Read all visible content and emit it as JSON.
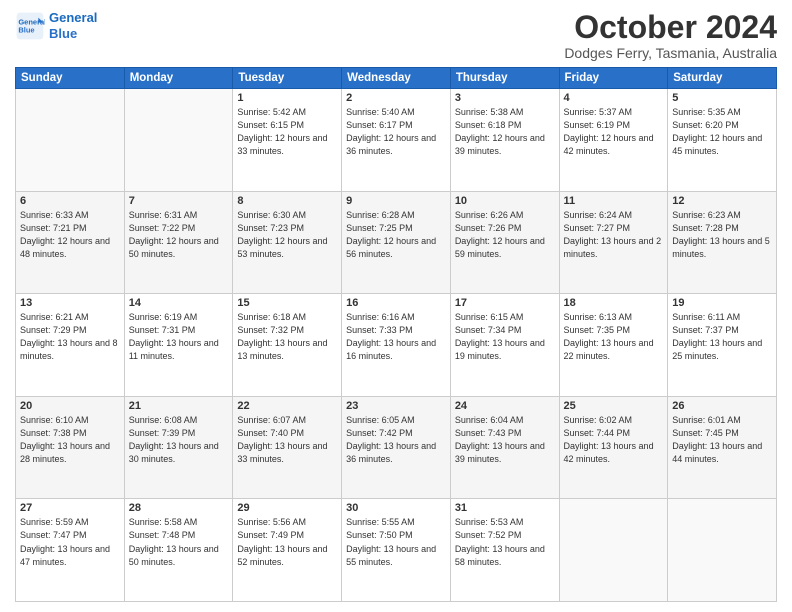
{
  "header": {
    "logo_line1": "General",
    "logo_line2": "Blue",
    "title": "October 2024",
    "subtitle": "Dodges Ferry, Tasmania, Australia"
  },
  "weekdays": [
    "Sunday",
    "Monday",
    "Tuesday",
    "Wednesday",
    "Thursday",
    "Friday",
    "Saturday"
  ],
  "weeks": [
    [
      {
        "day": "",
        "sunrise": "",
        "sunset": "",
        "daylight": ""
      },
      {
        "day": "",
        "sunrise": "",
        "sunset": "",
        "daylight": ""
      },
      {
        "day": "1",
        "sunrise": "Sunrise: 5:42 AM",
        "sunset": "Sunset: 6:15 PM",
        "daylight": "Daylight: 12 hours and 33 minutes."
      },
      {
        "day": "2",
        "sunrise": "Sunrise: 5:40 AM",
        "sunset": "Sunset: 6:17 PM",
        "daylight": "Daylight: 12 hours and 36 minutes."
      },
      {
        "day": "3",
        "sunrise": "Sunrise: 5:38 AM",
        "sunset": "Sunset: 6:18 PM",
        "daylight": "Daylight: 12 hours and 39 minutes."
      },
      {
        "day": "4",
        "sunrise": "Sunrise: 5:37 AM",
        "sunset": "Sunset: 6:19 PM",
        "daylight": "Daylight: 12 hours and 42 minutes."
      },
      {
        "day": "5",
        "sunrise": "Sunrise: 5:35 AM",
        "sunset": "Sunset: 6:20 PM",
        "daylight": "Daylight: 12 hours and 45 minutes."
      }
    ],
    [
      {
        "day": "6",
        "sunrise": "Sunrise: 6:33 AM",
        "sunset": "Sunset: 7:21 PM",
        "daylight": "Daylight: 12 hours and 48 minutes."
      },
      {
        "day": "7",
        "sunrise": "Sunrise: 6:31 AM",
        "sunset": "Sunset: 7:22 PM",
        "daylight": "Daylight: 12 hours and 50 minutes."
      },
      {
        "day": "8",
        "sunrise": "Sunrise: 6:30 AM",
        "sunset": "Sunset: 7:23 PM",
        "daylight": "Daylight: 12 hours and 53 minutes."
      },
      {
        "day": "9",
        "sunrise": "Sunrise: 6:28 AM",
        "sunset": "Sunset: 7:25 PM",
        "daylight": "Daylight: 12 hours and 56 minutes."
      },
      {
        "day": "10",
        "sunrise": "Sunrise: 6:26 AM",
        "sunset": "Sunset: 7:26 PM",
        "daylight": "Daylight: 12 hours and 59 minutes."
      },
      {
        "day": "11",
        "sunrise": "Sunrise: 6:24 AM",
        "sunset": "Sunset: 7:27 PM",
        "daylight": "Daylight: 13 hours and 2 minutes."
      },
      {
        "day": "12",
        "sunrise": "Sunrise: 6:23 AM",
        "sunset": "Sunset: 7:28 PM",
        "daylight": "Daylight: 13 hours and 5 minutes."
      }
    ],
    [
      {
        "day": "13",
        "sunrise": "Sunrise: 6:21 AM",
        "sunset": "Sunset: 7:29 PM",
        "daylight": "Daylight: 13 hours and 8 minutes."
      },
      {
        "day": "14",
        "sunrise": "Sunrise: 6:19 AM",
        "sunset": "Sunset: 7:31 PM",
        "daylight": "Daylight: 13 hours and 11 minutes."
      },
      {
        "day": "15",
        "sunrise": "Sunrise: 6:18 AM",
        "sunset": "Sunset: 7:32 PM",
        "daylight": "Daylight: 13 hours and 13 minutes."
      },
      {
        "day": "16",
        "sunrise": "Sunrise: 6:16 AM",
        "sunset": "Sunset: 7:33 PM",
        "daylight": "Daylight: 13 hours and 16 minutes."
      },
      {
        "day": "17",
        "sunrise": "Sunrise: 6:15 AM",
        "sunset": "Sunset: 7:34 PM",
        "daylight": "Daylight: 13 hours and 19 minutes."
      },
      {
        "day": "18",
        "sunrise": "Sunrise: 6:13 AM",
        "sunset": "Sunset: 7:35 PM",
        "daylight": "Daylight: 13 hours and 22 minutes."
      },
      {
        "day": "19",
        "sunrise": "Sunrise: 6:11 AM",
        "sunset": "Sunset: 7:37 PM",
        "daylight": "Daylight: 13 hours and 25 minutes."
      }
    ],
    [
      {
        "day": "20",
        "sunrise": "Sunrise: 6:10 AM",
        "sunset": "Sunset: 7:38 PM",
        "daylight": "Daylight: 13 hours and 28 minutes."
      },
      {
        "day": "21",
        "sunrise": "Sunrise: 6:08 AM",
        "sunset": "Sunset: 7:39 PM",
        "daylight": "Daylight: 13 hours and 30 minutes."
      },
      {
        "day": "22",
        "sunrise": "Sunrise: 6:07 AM",
        "sunset": "Sunset: 7:40 PM",
        "daylight": "Daylight: 13 hours and 33 minutes."
      },
      {
        "day": "23",
        "sunrise": "Sunrise: 6:05 AM",
        "sunset": "Sunset: 7:42 PM",
        "daylight": "Daylight: 13 hours and 36 minutes."
      },
      {
        "day": "24",
        "sunrise": "Sunrise: 6:04 AM",
        "sunset": "Sunset: 7:43 PM",
        "daylight": "Daylight: 13 hours and 39 minutes."
      },
      {
        "day": "25",
        "sunrise": "Sunrise: 6:02 AM",
        "sunset": "Sunset: 7:44 PM",
        "daylight": "Daylight: 13 hours and 42 minutes."
      },
      {
        "day": "26",
        "sunrise": "Sunrise: 6:01 AM",
        "sunset": "Sunset: 7:45 PM",
        "daylight": "Daylight: 13 hours and 44 minutes."
      }
    ],
    [
      {
        "day": "27",
        "sunrise": "Sunrise: 5:59 AM",
        "sunset": "Sunset: 7:47 PM",
        "daylight": "Daylight: 13 hours and 47 minutes."
      },
      {
        "day": "28",
        "sunrise": "Sunrise: 5:58 AM",
        "sunset": "Sunset: 7:48 PM",
        "daylight": "Daylight: 13 hours and 50 minutes."
      },
      {
        "day": "29",
        "sunrise": "Sunrise: 5:56 AM",
        "sunset": "Sunset: 7:49 PM",
        "daylight": "Daylight: 13 hours and 52 minutes."
      },
      {
        "day": "30",
        "sunrise": "Sunrise: 5:55 AM",
        "sunset": "Sunset: 7:50 PM",
        "daylight": "Daylight: 13 hours and 55 minutes."
      },
      {
        "day": "31",
        "sunrise": "Sunrise: 5:53 AM",
        "sunset": "Sunset: 7:52 PM",
        "daylight": "Daylight: 13 hours and 58 minutes."
      },
      {
        "day": "",
        "sunrise": "",
        "sunset": "",
        "daylight": ""
      },
      {
        "day": "",
        "sunrise": "",
        "sunset": "",
        "daylight": ""
      }
    ]
  ]
}
